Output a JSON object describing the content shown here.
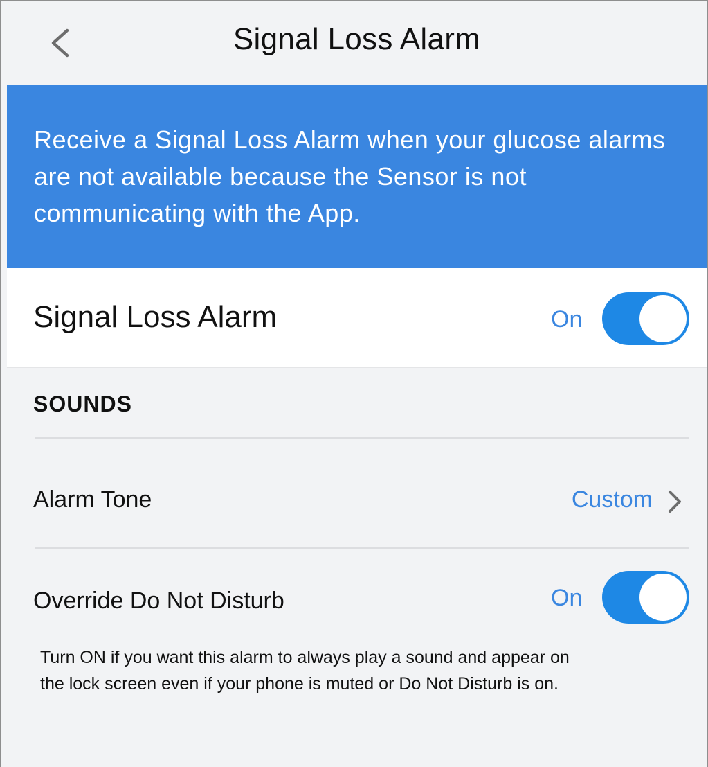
{
  "header": {
    "title": "Signal Loss Alarm",
    "back_icon": "chevron-left-icon"
  },
  "banner": {
    "text": "Receive a Signal Loss Alarm when your glucose alarms are not available because the Sensor is not communicating with the App.",
    "background_color": "#3a86e0"
  },
  "main_setting": {
    "label": "Signal Loss Alarm",
    "state": "On",
    "enabled": true
  },
  "sounds_section": {
    "header": "SOUNDS",
    "alarm_tone": {
      "label": "Alarm Tone",
      "value": "Custom",
      "icon": "chevron-right-icon"
    },
    "override_dnd": {
      "label": "Override Do Not Disturb",
      "state": "On",
      "enabled": true,
      "help_text": "Turn ON if you want this alarm to always play a sound and appear on the lock screen even if your phone is muted or Do Not Disturb is on."
    }
  },
  "colors": {
    "accent": "#3a86e0",
    "toggle_on": "#1e88e5",
    "background": "#f2f3f5"
  }
}
